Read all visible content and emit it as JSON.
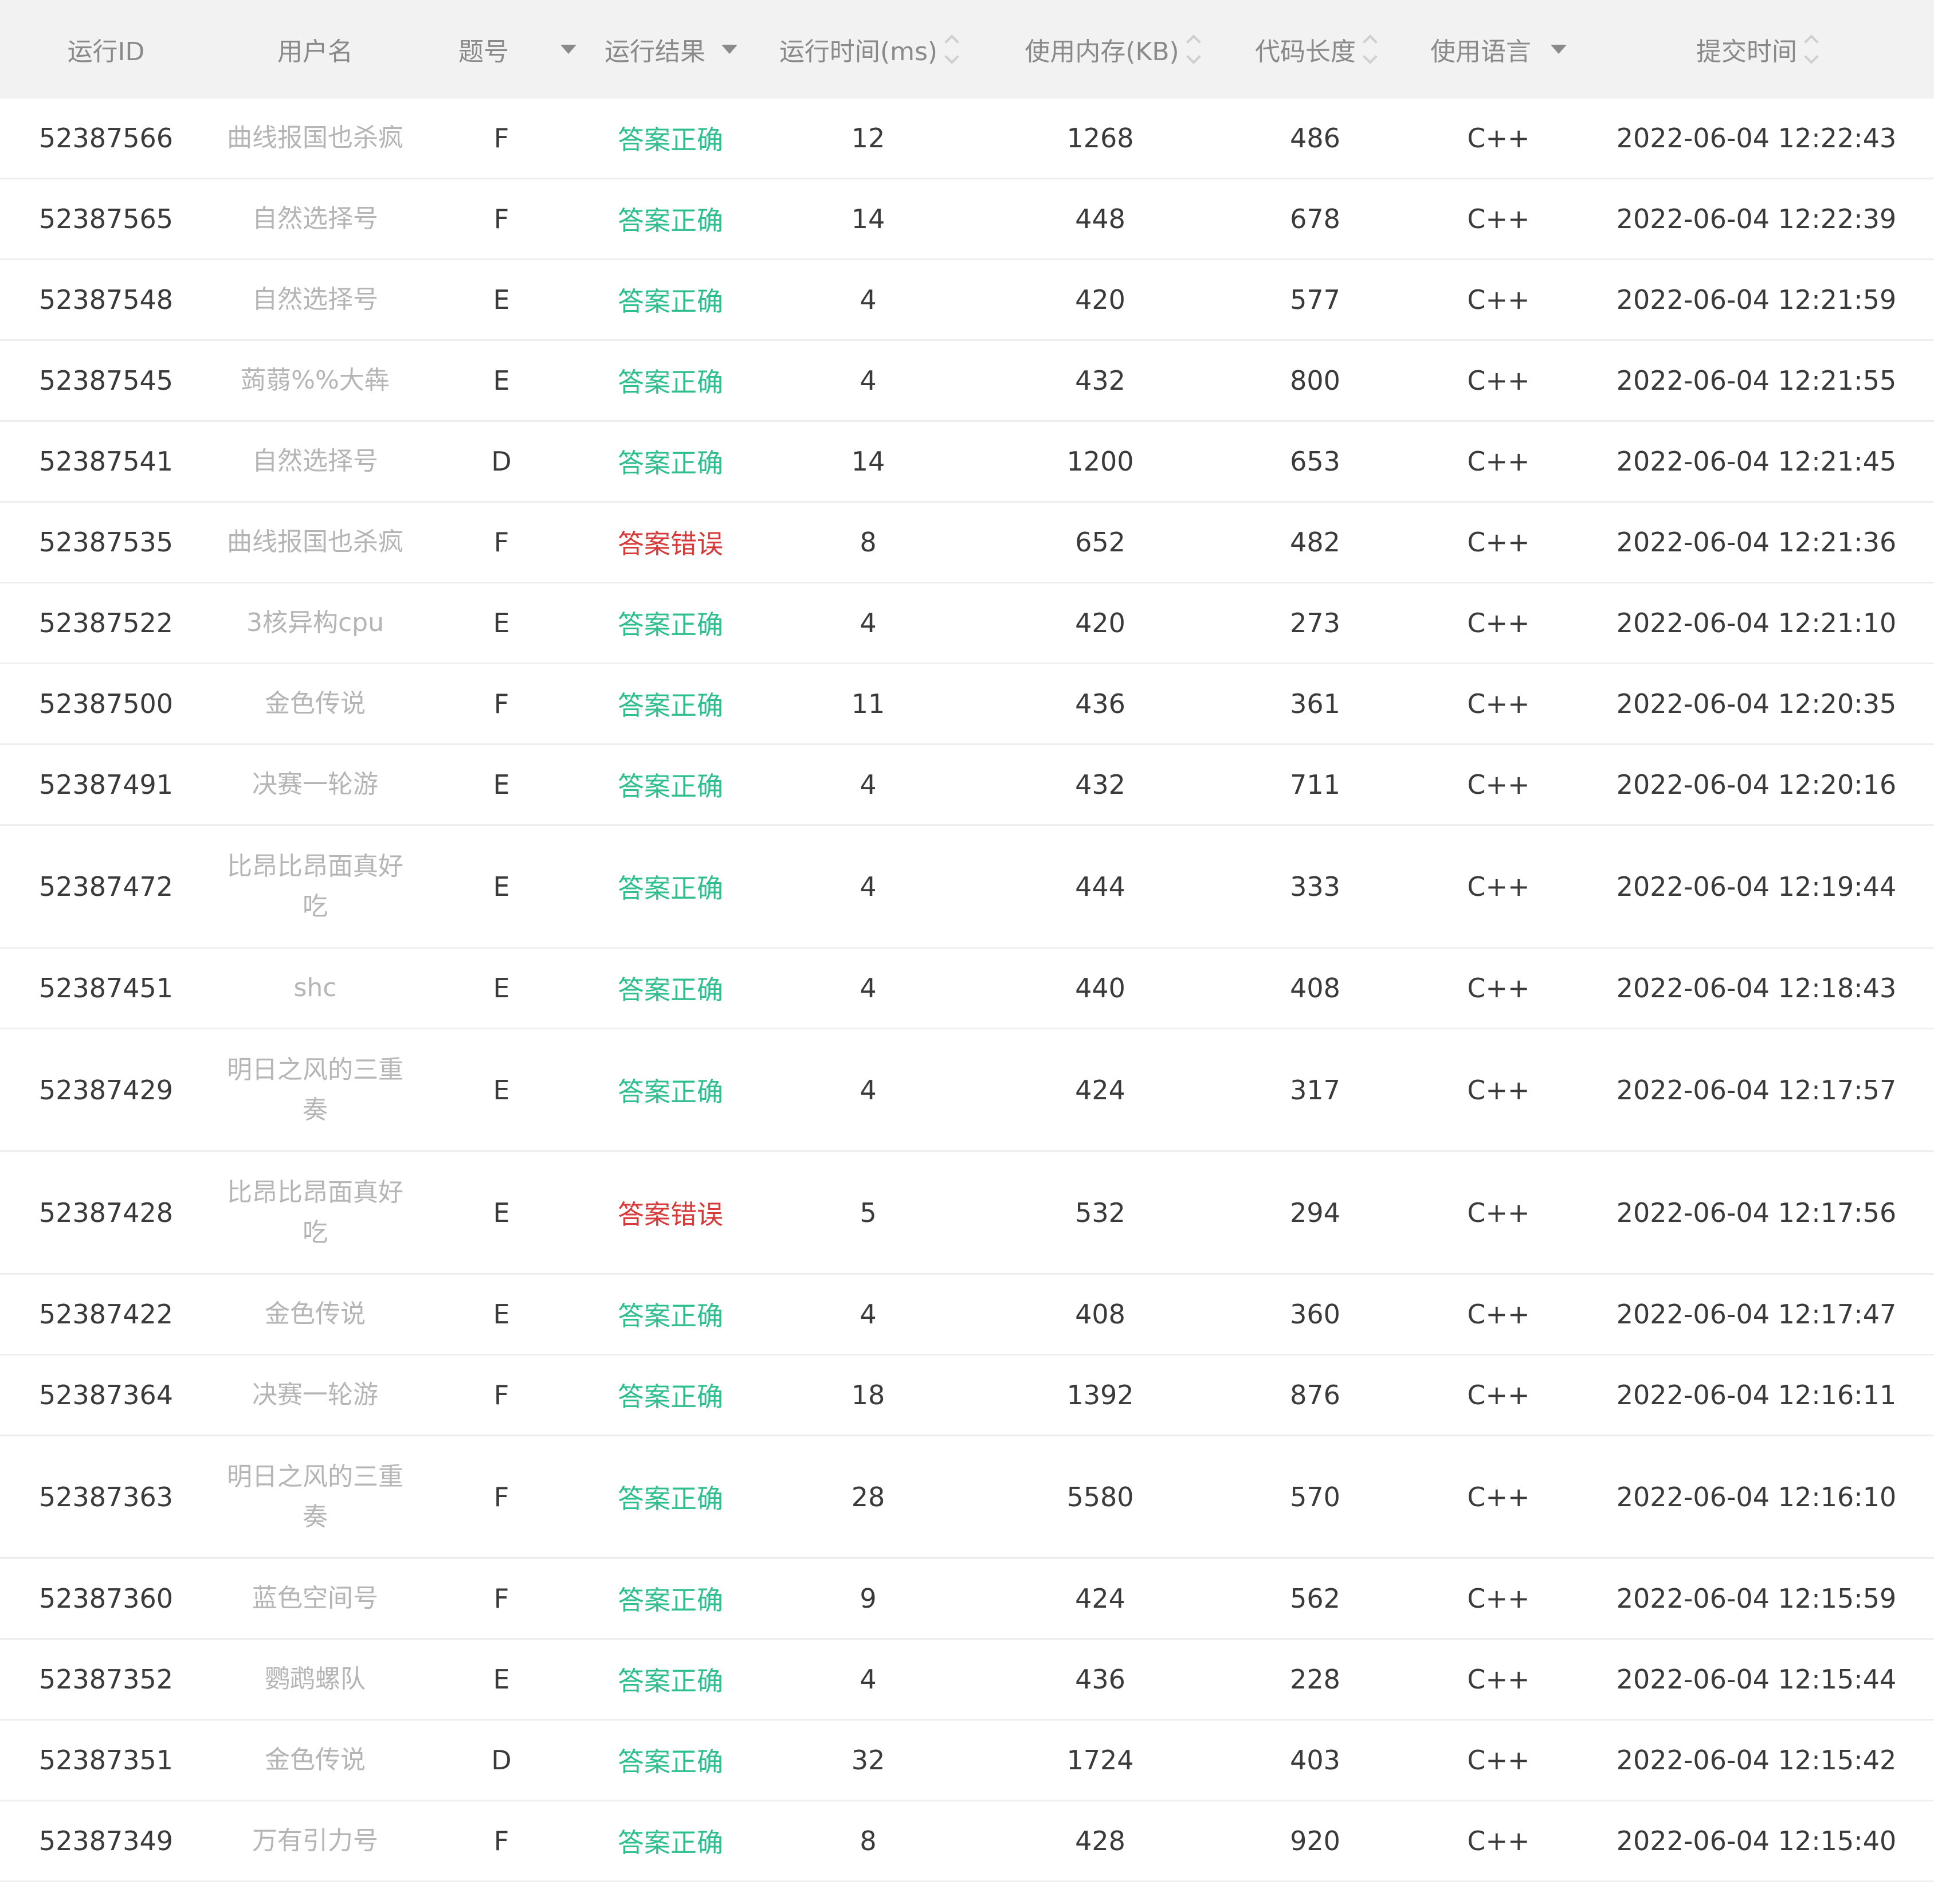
{
  "columns": {
    "run_id": "运行ID",
    "username": "用户名",
    "problem": "题号",
    "result": "运行结果",
    "run_time": "运行时间(ms)",
    "memory": "使用内存(KB)",
    "code_length": "代码长度",
    "language": "使用语言",
    "submit_time": "提交时间"
  },
  "colors": {
    "accepted": "#2fbf8f",
    "wrong": "#d83a3a",
    "header_bg": "#f2f2f2"
  },
  "rows": [
    {
      "id": "52387566",
      "user": "曲线报国也杀疯",
      "prob": "F",
      "result": "答案正确",
      "status": "ok",
      "time": "12",
      "mem": "1268",
      "len": "486",
      "lang": "C++",
      "submitted": "2022-06-04 12:22:43"
    },
    {
      "id": "52387565",
      "user": "自然选择号",
      "prob": "F",
      "result": "答案正确",
      "status": "ok",
      "time": "14",
      "mem": "448",
      "len": "678",
      "lang": "C++",
      "submitted": "2022-06-04 12:22:39"
    },
    {
      "id": "52387548",
      "user": "自然选择号",
      "prob": "E",
      "result": "答案正确",
      "status": "ok",
      "time": "4",
      "mem": "420",
      "len": "577",
      "lang": "C++",
      "submitted": "2022-06-04 12:21:59"
    },
    {
      "id": "52387545",
      "user": "蒟蒻%%大犇",
      "prob": "E",
      "result": "答案正确",
      "status": "ok",
      "time": "4",
      "mem": "432",
      "len": "800",
      "lang": "C++",
      "submitted": "2022-06-04 12:21:55"
    },
    {
      "id": "52387541",
      "user": "自然选择号",
      "prob": "D",
      "result": "答案正确",
      "status": "ok",
      "time": "14",
      "mem": "1200",
      "len": "653",
      "lang": "C++",
      "submitted": "2022-06-04 12:21:45"
    },
    {
      "id": "52387535",
      "user": "曲线报国也杀疯",
      "prob": "F",
      "result": "答案错误",
      "status": "err",
      "time": "8",
      "mem": "652",
      "len": "482",
      "lang": "C++",
      "submitted": "2022-06-04 12:21:36"
    },
    {
      "id": "52387522",
      "user": "3核异构cpu",
      "prob": "E",
      "result": "答案正确",
      "status": "ok",
      "time": "4",
      "mem": "420",
      "len": "273",
      "lang": "C++",
      "submitted": "2022-06-04 12:21:10"
    },
    {
      "id": "52387500",
      "user": "金色传说",
      "prob": "F",
      "result": "答案正确",
      "status": "ok",
      "time": "11",
      "mem": "436",
      "len": "361",
      "lang": "C++",
      "submitted": "2022-06-04 12:20:35"
    },
    {
      "id": "52387491",
      "user": "决赛一轮游",
      "prob": "E",
      "result": "答案正确",
      "status": "ok",
      "time": "4",
      "mem": "432",
      "len": "711",
      "lang": "C++",
      "submitted": "2022-06-04 12:20:16"
    },
    {
      "id": "52387472",
      "user": "比昂比昂面真好吃",
      "prob": "E",
      "result": "答案正确",
      "status": "ok",
      "time": "4",
      "mem": "444",
      "len": "333",
      "lang": "C++",
      "submitted": "2022-06-04 12:19:44"
    },
    {
      "id": "52387451",
      "user": "shc",
      "prob": "E",
      "result": "答案正确",
      "status": "ok",
      "time": "4",
      "mem": "440",
      "len": "408",
      "lang": "C++",
      "submitted": "2022-06-04 12:18:43"
    },
    {
      "id": "52387429",
      "user": "明日之风的三重奏",
      "prob": "E",
      "result": "答案正确",
      "status": "ok",
      "time": "4",
      "mem": "424",
      "len": "317",
      "lang": "C++",
      "submitted": "2022-06-04 12:17:57"
    },
    {
      "id": "52387428",
      "user": "比昂比昂面真好吃",
      "prob": "E",
      "result": "答案错误",
      "status": "err",
      "time": "5",
      "mem": "532",
      "len": "294",
      "lang": "C++",
      "submitted": "2022-06-04 12:17:56"
    },
    {
      "id": "52387422",
      "user": "金色传说",
      "prob": "E",
      "result": "答案正确",
      "status": "ok",
      "time": "4",
      "mem": "408",
      "len": "360",
      "lang": "C++",
      "submitted": "2022-06-04 12:17:47"
    },
    {
      "id": "52387364",
      "user": "决赛一轮游",
      "prob": "F",
      "result": "答案正确",
      "status": "ok",
      "time": "18",
      "mem": "1392",
      "len": "876",
      "lang": "C++",
      "submitted": "2022-06-04 12:16:11"
    },
    {
      "id": "52387363",
      "user": "明日之风的三重奏",
      "prob": "F",
      "result": "答案正确",
      "status": "ok",
      "time": "28",
      "mem": "5580",
      "len": "570",
      "lang": "C++",
      "submitted": "2022-06-04 12:16:10"
    },
    {
      "id": "52387360",
      "user": "蓝色空间号",
      "prob": "F",
      "result": "答案正确",
      "status": "ok",
      "time": "9",
      "mem": "424",
      "len": "562",
      "lang": "C++",
      "submitted": "2022-06-04 12:15:59"
    },
    {
      "id": "52387352",
      "user": "鹦鹉螺队",
      "prob": "E",
      "result": "答案正确",
      "status": "ok",
      "time": "4",
      "mem": "436",
      "len": "228",
      "lang": "C++",
      "submitted": "2022-06-04 12:15:44"
    },
    {
      "id": "52387351",
      "user": "金色传说",
      "prob": "D",
      "result": "答案正确",
      "status": "ok",
      "time": "32",
      "mem": "1724",
      "len": "403",
      "lang": "C++",
      "submitted": "2022-06-04 12:15:42"
    },
    {
      "id": "52387349",
      "user": "万有引力号",
      "prob": "F",
      "result": "答案正确",
      "status": "ok",
      "time": "8",
      "mem": "428",
      "len": "920",
      "lang": "C++",
      "submitted": "2022-06-04 12:15:40"
    }
  ]
}
